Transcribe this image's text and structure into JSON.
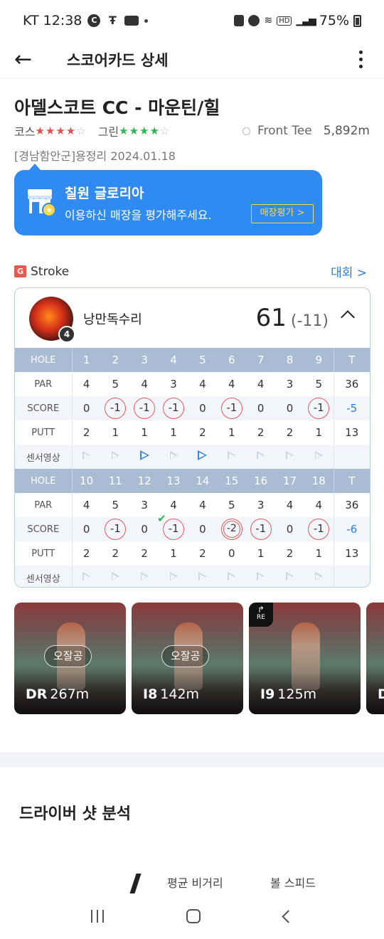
{
  "status_bar": {
    "carrier_time": "KT 12:38",
    "battery": "75%"
  },
  "app_bar": {
    "title": "스코어카드 상세"
  },
  "course": {
    "name": "아델스코트 CC - 마운틴/힐",
    "course_label": "코스",
    "course_stars_filled": 4,
    "green_label": "그린",
    "green_stars_filled": 4,
    "tee": "Front Tee",
    "distance": "5,892m",
    "location_date": "[경남함안군]용정리 2024.01.18"
  },
  "store_banner": {
    "name": "칠원 글로리아",
    "message": "이용하신 매장을 평가해주세요.",
    "button": "매장평가 >"
  },
  "mode": {
    "badge": "G",
    "label": "Stroke",
    "tournament_link": "대회 >"
  },
  "player": {
    "name": "낭만독수리",
    "level": "4",
    "total": "61",
    "diff": "(-11)"
  },
  "scorecard": {
    "labels": {
      "hole": "HOLE",
      "par": "PAR",
      "score": "SCORE",
      "putt": "PUTT",
      "video": "센서영상",
      "total": "T"
    },
    "front": {
      "holes": [
        "1",
        "2",
        "3",
        "4",
        "5",
        "6",
        "7",
        "8",
        "9"
      ],
      "par": [
        "4",
        "5",
        "4",
        "3",
        "4",
        "4",
        "4",
        "3",
        "5"
      ],
      "par_total": "36",
      "score": [
        "0",
        "-1",
        "-1",
        "-1",
        "0",
        "-1",
        "0",
        "0",
        "-1"
      ],
      "score_total": "-5",
      "putt": [
        "2",
        "1",
        "1",
        "1",
        "2",
        "1",
        "2",
        "2",
        "1"
      ],
      "putt_total": "13"
    },
    "back": {
      "holes": [
        "10",
        "11",
        "12",
        "13",
        "14",
        "15",
        "16",
        "17",
        "18"
      ],
      "par": [
        "4",
        "5",
        "3",
        "4",
        "4",
        "5",
        "3",
        "4",
        "4"
      ],
      "par_total": "36",
      "score": [
        "0",
        "-1",
        "0",
        "-1",
        "0",
        "-2",
        "-1",
        "0",
        "-1"
      ],
      "score_total": "-6",
      "putt": [
        "2",
        "2",
        "2",
        "1",
        "2",
        "0",
        "1",
        "2",
        "1"
      ],
      "putt_total": "13"
    }
  },
  "shots": [
    {
      "tag": "오잘공",
      "club": "DR",
      "distance": "267m"
    },
    {
      "tag": "오잘공",
      "club": "I8",
      "distance": "142m"
    },
    {
      "tag": "",
      "club": "I9",
      "distance": "125m",
      "replay_badge": "RE"
    },
    {
      "tag": "",
      "club": "D",
      "distance": ""
    }
  ],
  "analysis": {
    "title": "드라이버 샷 분석",
    "avg_carry_label": "평균 비거리",
    "ball_speed_label": "볼 스피드"
  },
  "colors": {
    "accent_blue": "#2f8bf2",
    "birdie_circle": "#e35a5a",
    "header_row": "#a9bcd3",
    "button_yellow": "#ffd84a"
  }
}
